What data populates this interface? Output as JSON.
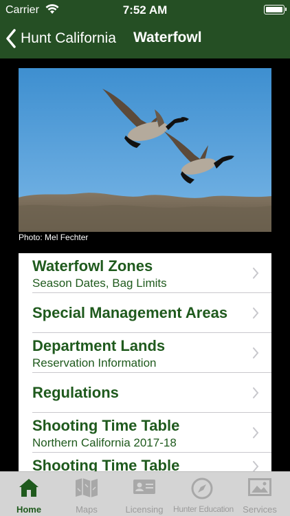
{
  "status_bar": {
    "carrier": "Carrier",
    "time": "7:52 AM"
  },
  "nav": {
    "back_label": "Hunt California",
    "title": "Waterfowl"
  },
  "hero": {
    "credit": "Photo: Mel Fechter"
  },
  "menu": {
    "items": [
      {
        "title": "Waterfowl Zones",
        "subtitle": "Season Dates, Bag Limits"
      },
      {
        "title": "Special Management Areas",
        "subtitle": ""
      },
      {
        "title": "Department Lands",
        "subtitle": "Reservation Information"
      },
      {
        "title": "Regulations",
        "subtitle": ""
      },
      {
        "title": "Shooting Time Table",
        "subtitle": "Northern California 2017-18"
      },
      {
        "title": "Shooting Time Table",
        "subtitle": ""
      }
    ]
  },
  "tabbar": {
    "tabs": [
      {
        "label": "Home",
        "icon": "home-icon",
        "active": true
      },
      {
        "label": "Maps",
        "icon": "map-icon",
        "active": false
      },
      {
        "label": "Licensing",
        "icon": "license-card-icon",
        "active": false
      },
      {
        "label": "Hunter Education",
        "icon": "compass-icon",
        "active": false
      },
      {
        "label": "Services",
        "icon": "picture-icon",
        "active": false
      }
    ]
  },
  "colors": {
    "header_green": "#254f24",
    "text_green": "#1f5a1d",
    "tab_inactive": "#9b9b9b"
  }
}
